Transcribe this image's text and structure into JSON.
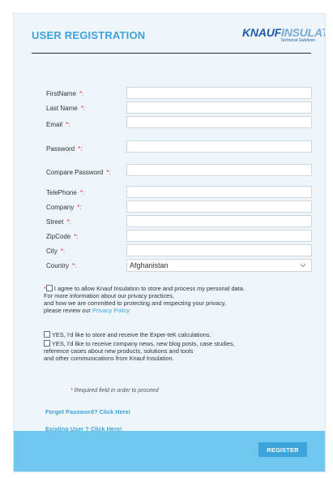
{
  "header": {
    "title": "USER REGISTRATION",
    "logo": {
      "brand": "KNAUF",
      "product": "INSULATION",
      "subtitle": "Technical Solutions"
    }
  },
  "form": {
    "fields": [
      {
        "label": "FirstName",
        "value": ""
      },
      {
        "label": "Last Name",
        "value": ""
      },
      {
        "label": "Email",
        "value": ""
      },
      {
        "label": "Password",
        "value": ""
      },
      {
        "label": "Compare Password",
        "value": ""
      },
      {
        "label": "TelePhone",
        "value": ""
      },
      {
        "label": "Company",
        "value": ""
      },
      {
        "label": "Street",
        "value": ""
      },
      {
        "label": "ZipCode",
        "value": ""
      },
      {
        "label": "City",
        "value": ""
      }
    ],
    "country": {
      "label": "Country",
      "selected": "Afghanistan"
    },
    "required_marker": "*:"
  },
  "consent": {
    "required_star": "*",
    "text1": "I agree to allow Knauf Insulation to store and process my personal data.",
    "text2": "For more information about our privacy practices,",
    "text3": "and how we are committed to protecting and respecting your privacy,",
    "text4": "please review our ",
    "privacy_link": "Privacy Policy"
  },
  "optins": {
    "opt1": "YES, I'd like to store and receive the Exper-teK calculations.",
    "opt2_line1": "YES, I'd like to receive company news, new blog posts, case studies,",
    "opt2_line2": "reference cases about new products, solutions and tools",
    "opt2_line3": "and other communications from Knauf Insulation."
  },
  "notes": {
    "required_star": "*",
    "required": "Required field in order to proceed"
  },
  "links": {
    "forgot": "Forget Password? Click Here!",
    "existing": "Existing User ? Click Here!"
  },
  "actions": {
    "register": "REGISTER"
  },
  "colors": {
    "accent": "#3ca3db",
    "footer": "#6fc7ef",
    "required": "#d9342b",
    "brand": "#1f5ba8"
  }
}
